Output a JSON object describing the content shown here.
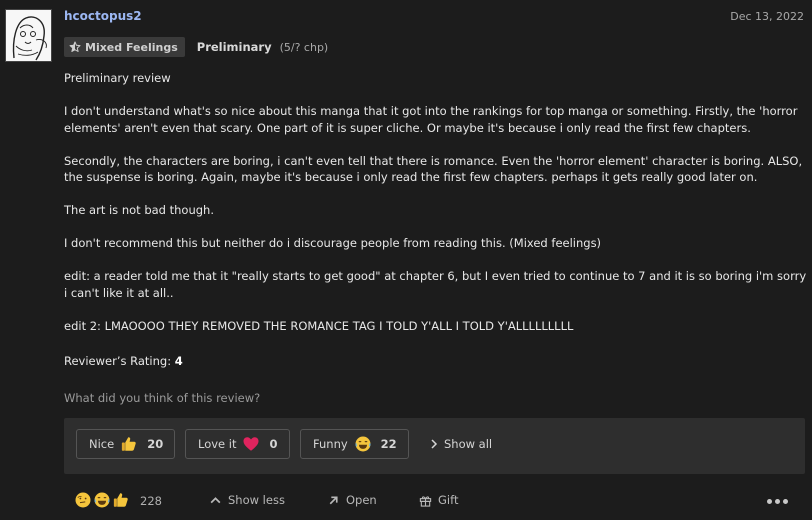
{
  "review": {
    "username": "hcoctopus2",
    "date": "Dec 13, 2022",
    "badge_label": "Mixed Feelings",
    "status": "Preliminary",
    "chapters": "(5/? chp)",
    "paragraphs": [
      "Preliminary review",
      "I don't understand what's so nice about this manga that it got into the rankings for top manga or something. Firstly, the 'horror elements' aren't even that scary. One part of it is super cliche. Or maybe it's because i only read the first few chapters.",
      "Secondly, the characters are boring, i can't even tell that there is romance. Even the 'horror element' character is boring. ALSO, the suspense is boring. Again, maybe it's because i only read the first few chapters. perhaps it gets really good later on.",
      "The art is not bad though.",
      "I don't recommend this but neither do i discourage people from reading this. (Mixed feelings)",
      "edit: a reader told me that it \"really starts to get good\" at chapter 6, but I even tried to continue to 7 and it is so boring i'm sorry i can't like it at all..",
      "edit 2: LMAOOOO THEY REMOVED THE ROMANCE TAG I TOLD Y'ALL I TOLD Y'ALLLLLLLLL"
    ],
    "rating_label": "Reviewer’s Rating:",
    "rating_value": "4",
    "prompt": "What did you think of this review?"
  },
  "reactions": {
    "nice": {
      "label": "Nice",
      "count": "20",
      "icon": "thumbs-up-icon"
    },
    "love": {
      "label": "Love it",
      "count": "0",
      "icon": "heart-icon"
    },
    "funny": {
      "label": "Funny",
      "count": "22",
      "icon": "laughing-face-icon"
    },
    "show_all": "Show all"
  },
  "footer": {
    "total": "228",
    "show_less": "Show less",
    "open": "Open",
    "gift": "Gift"
  },
  "colors": {
    "background": "#1c1c1c",
    "panel": "#2e2e2e",
    "username": "#9cb7f2",
    "heart": "#e0245e",
    "emoji": "#f5c53c"
  }
}
